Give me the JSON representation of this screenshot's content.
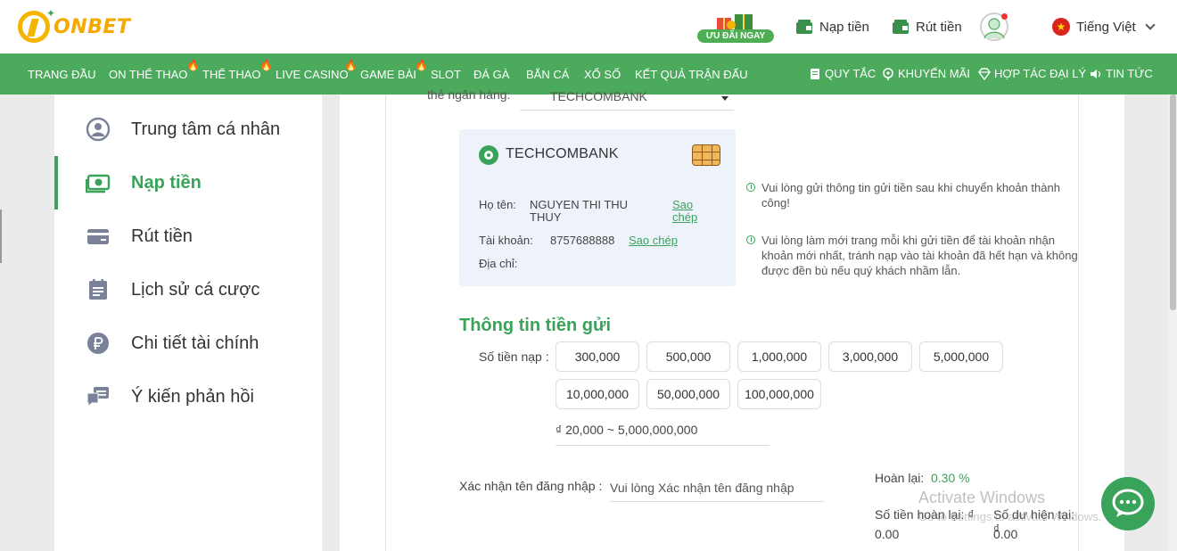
{
  "brand": {
    "name": "ONBET",
    "accent": "#4caa5c",
    "gold": "#f5a800"
  },
  "header": {
    "promo_label": "ƯU ĐÃI NGAY",
    "deposit_label": "Nạp tiền",
    "withdraw_label": "Rút tiền",
    "language_label": "Tiếng Việt"
  },
  "nav": {
    "items": [
      "TRANG ĐẦU",
      "ON THỂ THAO",
      "THỂ THAO",
      "LIVE CASINO",
      "GAME BÀI",
      "SLOT",
      "ĐÁ GÀ",
      "BẮN CÁ",
      "XỔ SỐ",
      "KẾT QUẢ TRẬN ĐẤU"
    ],
    "right_items": [
      "QUY TẮC",
      "KHUYẾN MÃI",
      "HỢP TÁC ĐẠI LÝ",
      "TIN TỨC"
    ]
  },
  "sidebar": {
    "items": [
      {
        "label": "Trung tâm cá nhân",
        "icon": "user-circle-icon",
        "active": false
      },
      {
        "label": "Nạp tiền",
        "icon": "cash-icon",
        "active": true
      },
      {
        "label": "Rút tiền",
        "icon": "card-icon",
        "active": false
      },
      {
        "label": "Lịch sử cá cược",
        "icon": "calendar-list-icon",
        "active": false
      },
      {
        "label": "Chi tiết tài chính",
        "icon": "ruble-coin-icon",
        "active": false
      },
      {
        "label": "Ý kiến phản hồi",
        "icon": "feedback-icon",
        "active": false
      }
    ]
  },
  "deposit": {
    "bank_field_label": "thẻ ngân hàng:",
    "bank_selected": "TECHCOMBANK",
    "card": {
      "bank_name": "TECHCOMBANK",
      "name_label": "Họ tên:",
      "name_value": "NGUYEN THI THU THUY",
      "account_label": "Tài khoản:",
      "account_value": "8757688888",
      "address_label": "Địa chỉ:",
      "copy_label": "Sao chép"
    },
    "notes": [
      "Vui lòng gửi thông tin gửi tiền sau khi chuyển khoản thành công!",
      "Vui lòng làm mới trang mỗi khi gửi tiền để tài khoản nhận khoản mới nhất, tránh nạp vào tài khoản đã hết hạn và không được đền bù nếu quý khách nhầm lẫn."
    ],
    "section_title": "Thông tin tiền gửi",
    "amount_label": "Số tiền nạp :",
    "amounts": [
      "300,000",
      "500,000",
      "1,000,000",
      "3,000,000",
      "5,000,000",
      "10,000,000",
      "50,000,000",
      "100,000,000"
    ],
    "range_text": "₫ 20,000 ~ 5,000,000,000",
    "confirm_label": "Xác nhận tên đăng nhập :",
    "confirm_placeholder": "Vui lòng Xác nhận tên đăng nhập",
    "rebate_label": "Hoàn lại:",
    "rebate_value": "0.30 %",
    "rebate_amount_label": "Số tiền hoàn lại: ₫",
    "rebate_amount_value": "0.00",
    "balance_label": "Số dư hiện tại: ₫",
    "balance_value": "0.00"
  },
  "watermark": {
    "line1": "Activate Windows",
    "line2": "Go to Settings to activate Windows."
  }
}
